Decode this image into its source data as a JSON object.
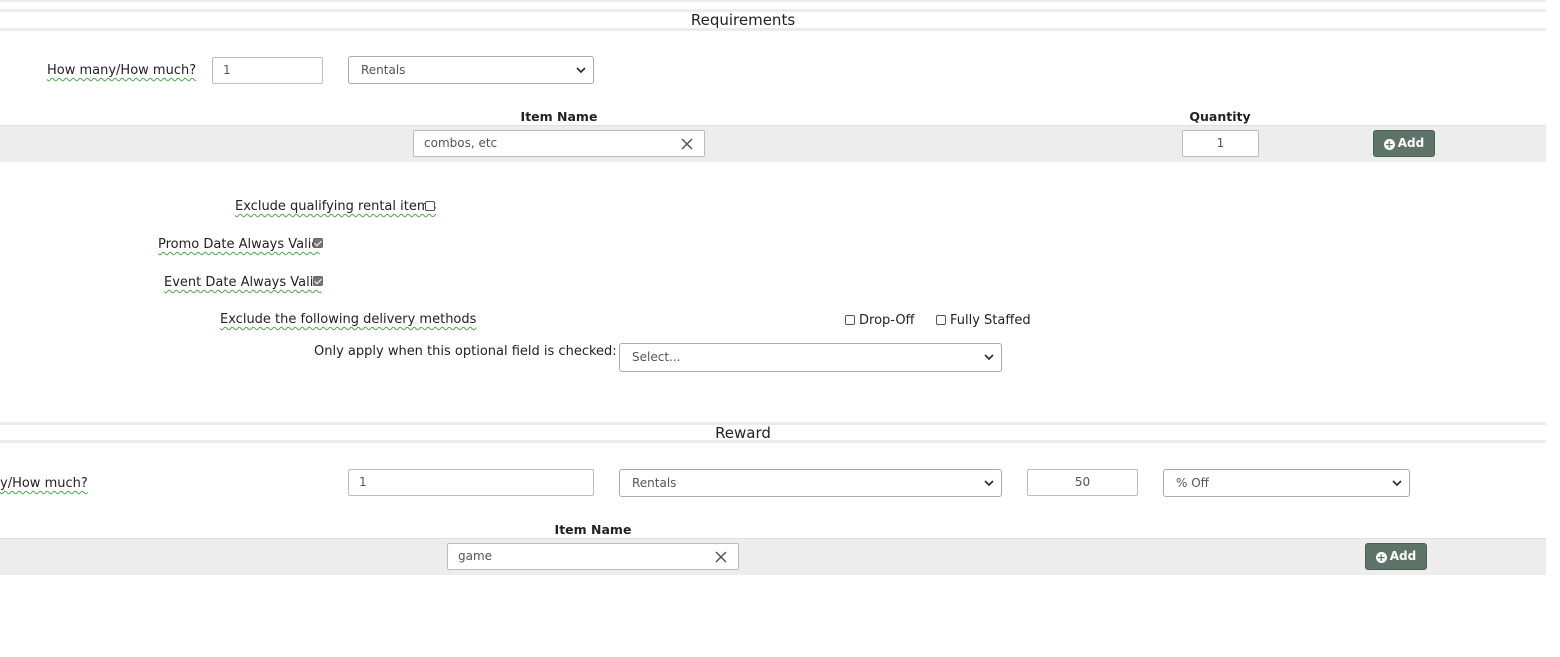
{
  "requirements": {
    "title": "Requirements",
    "how_many_label": "How many/How much?",
    "quantity_value": "1",
    "type_select": "Rentals",
    "item_name_header": "Item Name",
    "quantity_header": "Quantity",
    "item_value": "combos, etc",
    "item_quantity": "1",
    "add_label": "Add",
    "exclude_qualifying_label": "Exclude qualifying rental items",
    "exclude_qualifying_checked": false,
    "promo_date_label": "Promo Date Always Valid",
    "promo_date_checked": true,
    "event_date_label": "Event Date Always Valid",
    "event_date_checked": true,
    "exclude_delivery_label": "Exclude the following delivery methods",
    "delivery_methods": [
      {
        "label": "Drop-Off",
        "checked": false
      },
      {
        "label": "Fully Staffed",
        "checked": false
      }
    ],
    "optional_field_label": "Only apply when this optional field is checked:",
    "optional_field_select": "Select..."
  },
  "reward": {
    "title": "Reward",
    "how_many_label": "y/How much?",
    "quantity_value": "1",
    "type_select": "Rentals",
    "amount_value": "50",
    "discount_select": "% Off",
    "item_name_header": "Item Name",
    "item_value": "game",
    "add_label": "Add"
  }
}
